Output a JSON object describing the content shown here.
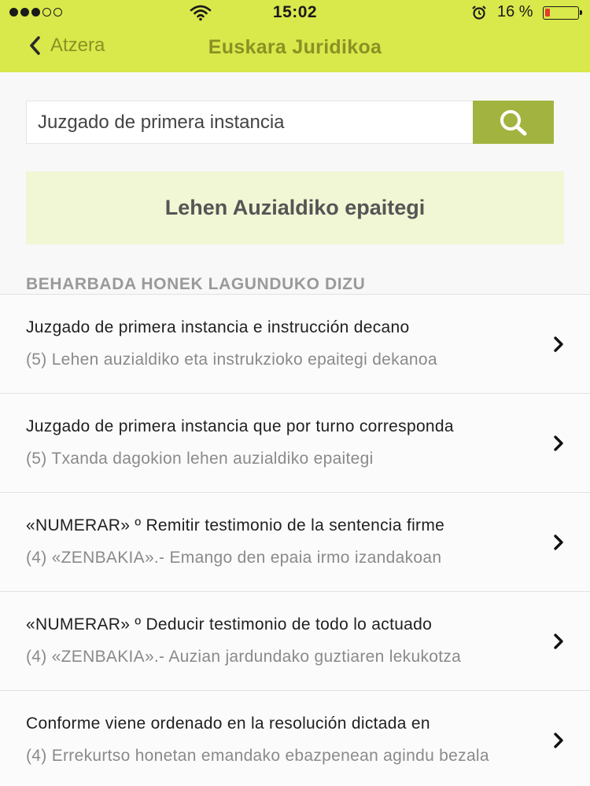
{
  "status_bar": {
    "time": "15:02",
    "battery_percent": "16 %",
    "battery_level": 0.16,
    "signal_bars_filled": 3,
    "signal_bars_total": 5
  },
  "nav": {
    "back_label": "Atzera",
    "title": "Euskara Juridikoa"
  },
  "search": {
    "value": "Juzgado de primera instancia"
  },
  "result": {
    "translation": "Lehen Auzialdiko epaitegi"
  },
  "suggestions": {
    "header": "BEHARBADA HONEK LAGUNDUKO DIZU",
    "items": [
      {
        "title": "Juzgado de primera instancia e instrucción decano",
        "subtitle": "(5) Lehen auzialdiko eta instrukzioko epaitegi dekanoa"
      },
      {
        "title": "Juzgado de primera instancia que por turno corresponda",
        "subtitle": "(5) Txanda dagokion lehen auzialdiko epaitegi"
      },
      {
        "title": "«NUMERAR» º Remitir testimonio de la sentencia firme",
        "subtitle": "(4) «ZENBAKIA».- Emango den epaia irmo izandakoan"
      },
      {
        "title": "«NUMERAR» º Deducir testimonio de todo lo actuado",
        "subtitle": "(4) «ZENBAKIA».- Auzian jardundako guztiaren lekukotza"
      },
      {
        "title": "Conforme viene ordenado en la resolución dictada en",
        "subtitle": "(4) Errekurtso honetan emandako ebazpenean agindu bezala"
      }
    ]
  },
  "colors": {
    "accent": "#d9e84b",
    "nav_text": "#8b9124",
    "search_button": "#a2b43f",
    "result_bg": "#f1f6d5"
  }
}
